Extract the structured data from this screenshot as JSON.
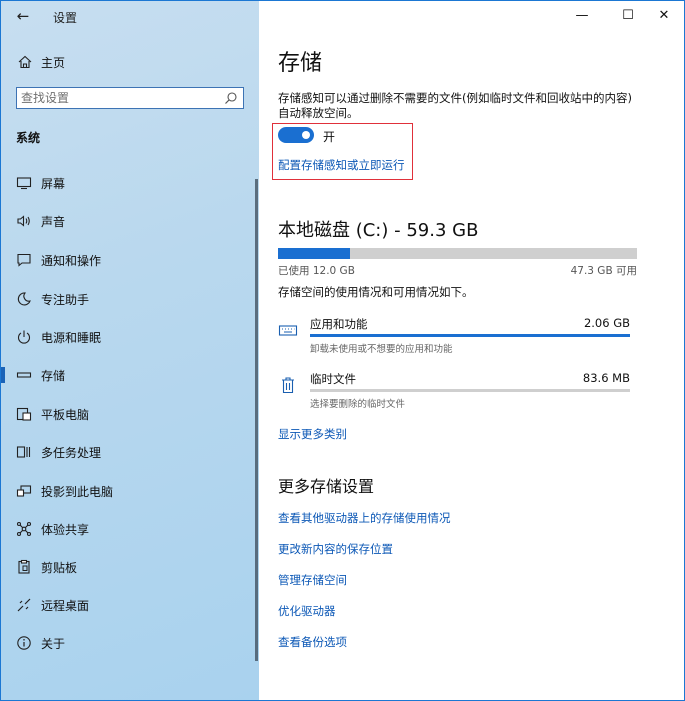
{
  "window": {
    "title": "设置",
    "controls": {
      "minimize": "—",
      "maximize": "☐",
      "close": "✕"
    }
  },
  "sidebar": {
    "back_glyph": "←",
    "home_label": "主页",
    "search_placeholder": "查找设置",
    "section_title": "系统",
    "items": [
      {
        "label": "屏幕",
        "icon": "display-icon"
      },
      {
        "label": "声音",
        "icon": "speaker-icon"
      },
      {
        "label": "通知和操作",
        "icon": "notification-icon"
      },
      {
        "label": "专注助手",
        "icon": "moon-icon"
      },
      {
        "label": "电源和睡眠",
        "icon": "power-icon"
      },
      {
        "label": "存储",
        "icon": "storage-icon",
        "active": true
      },
      {
        "label": "平板电脑",
        "icon": "tablet-icon"
      },
      {
        "label": "多任务处理",
        "icon": "multitask-icon"
      },
      {
        "label": "投影到此电脑",
        "icon": "project-icon"
      },
      {
        "label": "体验共享",
        "icon": "share-icon"
      },
      {
        "label": "剪贴板",
        "icon": "clipboard-icon"
      },
      {
        "label": "远程桌面",
        "icon": "remote-desktop-icon"
      },
      {
        "label": "关于",
        "icon": "info-icon"
      }
    ]
  },
  "main": {
    "title": "存储",
    "description": "存储感知可以通过删除不需要的文件(例如临时文件和回收站中的内容)自动释放空间。",
    "toggle_state": "开",
    "toggle_on": true,
    "configure_link": "配置存储感知或立即运行",
    "disk": {
      "title": "本地磁盘 (C:) - 59.3 GB",
      "used": "已使用 12.0 GB",
      "available": "47.3 GB 可用",
      "used_fraction": 0.2
    },
    "usage_desc": "存储空间的使用情况和可用情况如下。",
    "categories": [
      {
        "name": "应用和功能",
        "size": "2.06 GB",
        "sub": "卸载未使用或不想要的应用和功能",
        "fraction": 1.0,
        "icon": "keyboard-icon"
      },
      {
        "name": "临时文件",
        "size": "83.6 MB",
        "sub": "选择要删除的临时文件",
        "fraction": 0.0,
        "icon": "trash-icon"
      }
    ],
    "show_more": "显示更多类别",
    "more_title": "更多存储设置",
    "more_links": [
      "查看其他驱动器上的存储使用情况",
      "更改新内容的保存位置",
      "管理存储空间",
      "优化驱动器",
      "查看备份选项"
    ]
  }
}
